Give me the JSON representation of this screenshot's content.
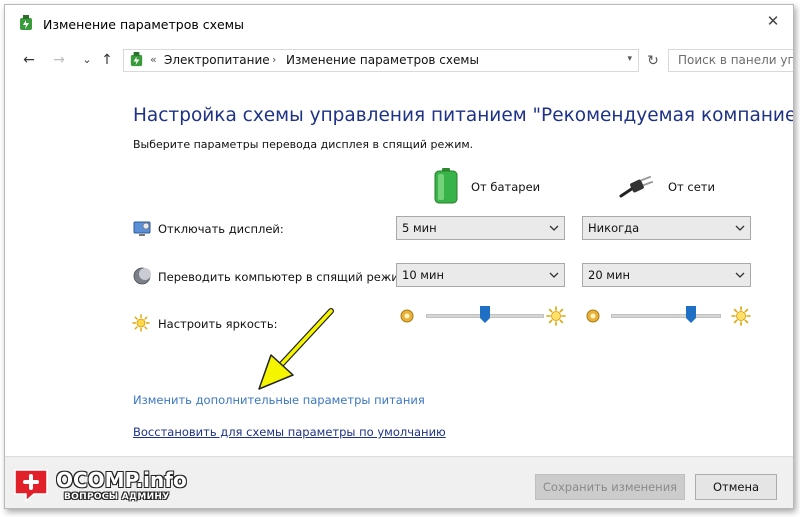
{
  "window": {
    "title": "Изменение параметров схемы",
    "close_glyph": "✕"
  },
  "nav": {
    "back_glyph": "←",
    "forward_glyph": "→",
    "recent_glyph": "⌄",
    "up_glyph": "↑",
    "breadcrumb_sep": "«",
    "breadcrumb": [
      "Электропитание",
      "Изменение параметров схемы"
    ],
    "crumb_chevron": "›",
    "dropdown_glyph": "▾",
    "refresh_glyph": "↻",
    "search_placeholder": "Поиск в панели упр"
  },
  "main": {
    "heading": "Настройка схемы управления питанием \"Рекомендуемая компанией HP\"",
    "subtitle": "Выберите параметры перевода дисплея в спящий режим.",
    "columns": {
      "battery_label": "От батареи",
      "ac_label": "От сети"
    },
    "rows": [
      {
        "label": "Отключать дисплей:",
        "battery_value": "5 мин",
        "ac_value": "Никогда"
      },
      {
        "label": "Переводить компьютер в спящий режим:",
        "battery_value": "10 мин",
        "ac_value": "20 мин"
      }
    ],
    "brightness": {
      "label": "Настроить яркость:",
      "battery_level_percent": 50,
      "ac_level_percent": 75
    },
    "links": {
      "advanced": "Изменить дополнительные параметры питания",
      "restore": "Восстановить для схемы параметры по умолчанию"
    }
  },
  "footer": {
    "save_label": "Сохранить изменения",
    "cancel_label": "Отмена"
  },
  "watermark": {
    "title": "OCOMP.info",
    "subtitle": "ВОПРОСЫ АДМИНУ"
  },
  "colors": {
    "heading": "#1e3287",
    "link": "#3b76c4",
    "slider_thumb": "#1f6fc5",
    "annotation_arrow": "#f5f500"
  },
  "icons": {
    "title": "power-options-icon",
    "battery": "battery-icon",
    "plug": "power-plug-icon",
    "display": "display-off-icon",
    "sleep": "sleep-moon-icon",
    "brightness": "brightness-sun-icon"
  }
}
